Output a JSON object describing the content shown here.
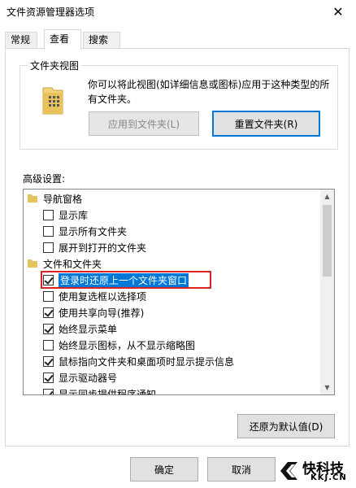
{
  "window": {
    "title": "文件资源管理器选项",
    "close": "✕"
  },
  "tabs": [
    {
      "label": "常规"
    },
    {
      "label": "查看"
    },
    {
      "label": "搜索"
    }
  ],
  "folder_views": {
    "legend": "文件夹视图",
    "description": "你可以将此视图(如详细信息或图标)应用于这种类型的所有文件夹。",
    "apply_button": "应用到文件夹(L)",
    "reset_button": "重置文件夹(R)"
  },
  "advanced": {
    "label": "高级设置:",
    "items": [
      {
        "type": "category",
        "label": "导航窗格"
      },
      {
        "type": "checkbox",
        "label": "显示库",
        "checked": false
      },
      {
        "type": "checkbox",
        "label": "显示所有文件夹",
        "checked": false
      },
      {
        "type": "checkbox",
        "label": "展开到打开的文件夹",
        "checked": false
      },
      {
        "type": "category",
        "label": "文件和文件夹"
      },
      {
        "type": "checkbox",
        "label": "登录时还原上一个文件夹窗口",
        "checked": true,
        "selected": true
      },
      {
        "type": "checkbox",
        "label": "使用复选框以选择项",
        "checked": false
      },
      {
        "type": "checkbox",
        "label": "使用共享向导(推荐)",
        "checked": true
      },
      {
        "type": "checkbox",
        "label": "始终显示菜单",
        "checked": true
      },
      {
        "type": "checkbox",
        "label": "始终显示图标，从不显示缩略图",
        "checked": false
      },
      {
        "type": "checkbox",
        "label": "鼠标指向文件夹和桌面项时显示提示信息",
        "checked": true
      },
      {
        "type": "checkbox",
        "label": "显示驱动器号",
        "checked": true
      },
      {
        "type": "checkbox",
        "label": "显示同步提供程序通知",
        "checked": true
      }
    ],
    "restore_defaults_button": "还原为默认值(D)"
  },
  "footer": {
    "ok_button": "确定",
    "cancel_button": "取消"
  },
  "watermark": {
    "line1": "快科技",
    "line2": "KKJ.CN"
  },
  "colors": {
    "accent": "#0078d7",
    "highlight": "#e02020",
    "folder": "#e8c25a"
  }
}
